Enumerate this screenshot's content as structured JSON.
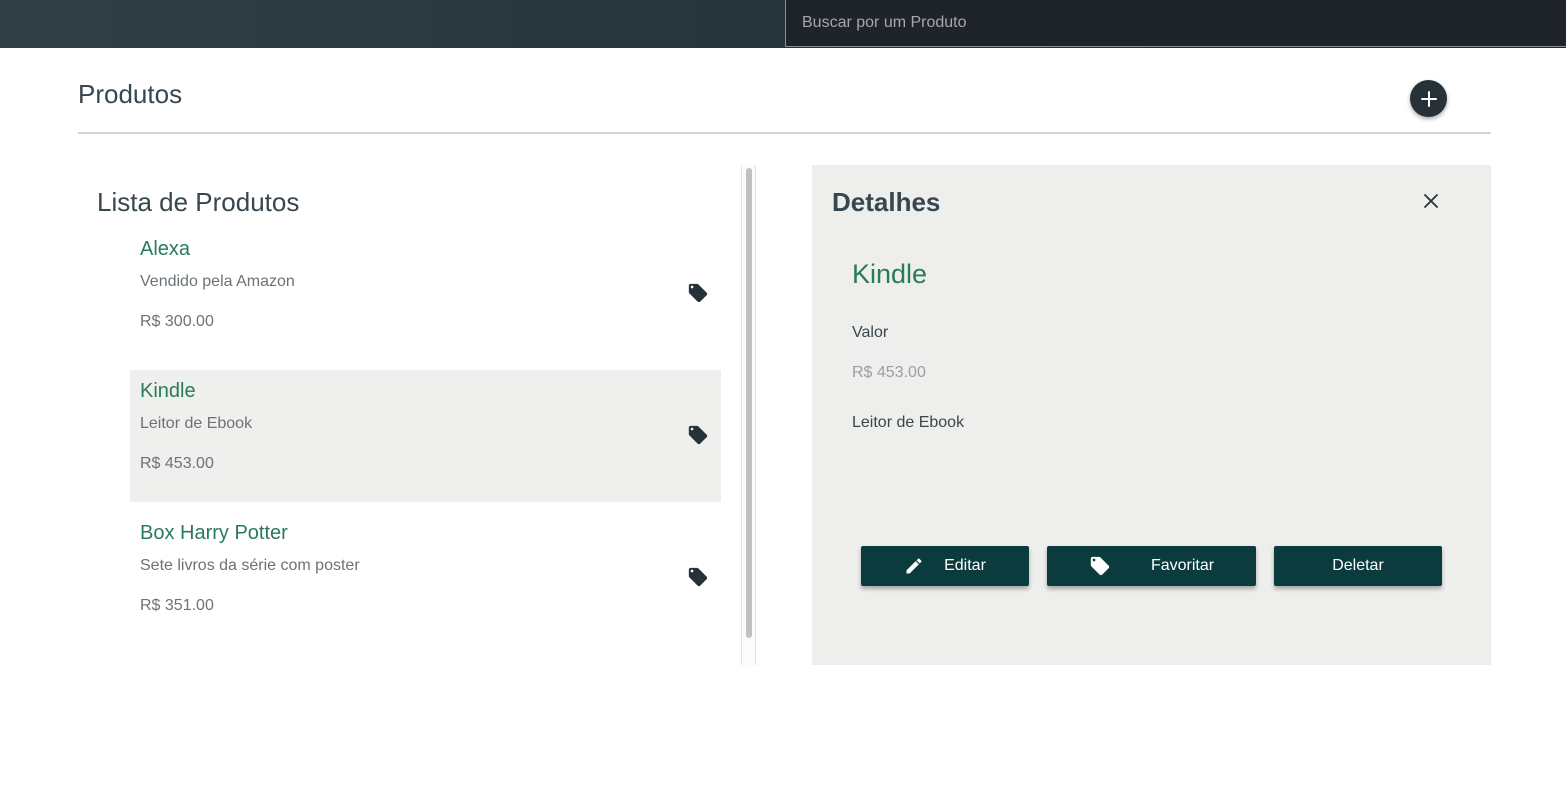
{
  "search": {
    "placeholder": "Buscar por um Produto",
    "value": ""
  },
  "header": {
    "title": "Produtos",
    "add_icon": "plus-icon"
  },
  "list": {
    "title": "Lista de Produtos",
    "items": [
      {
        "name": "Alexa",
        "description": "Vendido pela Amazon",
        "price": "R$ 300.00",
        "selected": false
      },
      {
        "name": "Kindle",
        "description": "Leitor de Ebook",
        "price": "R$ 453.00",
        "selected": true
      },
      {
        "name": "Box Harry Potter",
        "description": "Sete livros da série com poster",
        "price": "R$ 351.00",
        "selected": false
      }
    ]
  },
  "details": {
    "title": "Detalhes",
    "name": "Kindle",
    "value_label": "Valor",
    "price": "R$ 453.00",
    "description": "Leitor de Ebook",
    "buttons": {
      "edit": "Editar",
      "favorite": "Favoritar",
      "delete": "Deletar"
    }
  },
  "colors": {
    "accent_green": "#2a7a5c",
    "button_bg": "#0b3b3c",
    "topbar": "#27333a",
    "panel_bg": "#eeeeec"
  }
}
